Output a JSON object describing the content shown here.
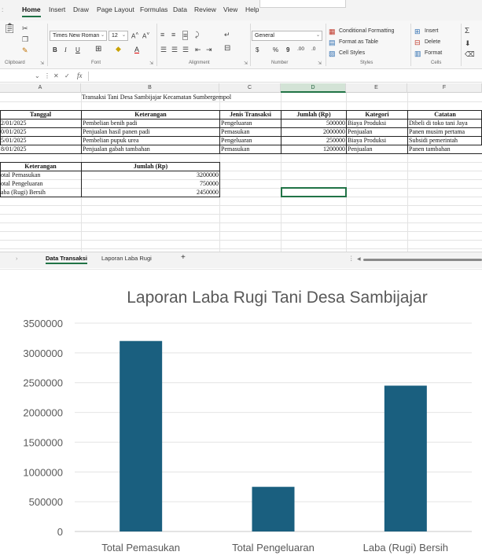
{
  "ribbon": {
    "tabs": [
      "Home",
      "Insert",
      "Draw",
      "Page Layout",
      "Formulas",
      "Data",
      "Review",
      "View",
      "Help"
    ],
    "font_name": "Times New Roman",
    "font_size": "12",
    "number_format": "General",
    "groups": {
      "clipboard": "Clipboard",
      "font": "Font",
      "alignment": "Alignment",
      "number": "Number",
      "styles": "Styles",
      "cells": "Cells"
    },
    "styles_items": [
      "Conditional Formatting",
      "Format as Table",
      "Cell Styles"
    ],
    "cells_items": [
      "Insert",
      "Delete",
      "Format"
    ],
    "number_symbols": [
      "$",
      "%",
      "9",
      ".00",
      ".0"
    ]
  },
  "formula_bar": {
    "fx": "fx"
  },
  "columns": [
    "A",
    "B",
    "C",
    "D",
    "E",
    "F"
  ],
  "sheet": {
    "title": "Transaksi Tani Desa Sambijajar Kecamatan Sumbergempol",
    "table_headers": [
      "Tanggal",
      "Keterangan",
      "Jenis Transaksi",
      "Jumlah (Rp)",
      "Kategori",
      "Catatan"
    ],
    "rows": [
      [
        "2/01/2025",
        "Pembelian benih padi",
        "Pengeluaran",
        "500000",
        "Biaya Produksi",
        "Dibeli di toko tani Jaya"
      ],
      [
        "0/01/2025",
        "Penjualan hasil panen padi",
        "Pemasukan",
        "2000000",
        "Penjualan",
        "Panen musim pertama"
      ],
      [
        "5/01/2025",
        "Pembelian pupuk urea",
        "Pengeluaran",
        "250000",
        "Biaya Produksi",
        "Subsidi pemerintah"
      ],
      [
        "8/01/2025",
        "Penjualan gabah tambahan",
        "Pemasukan",
        "1200000",
        "Penjualan",
        "Panen tambahan"
      ]
    ],
    "summary_headers": [
      "Keterangan",
      "Jumlah (Rp)"
    ],
    "summary_rows": [
      [
        "otal Pemasukan",
        "3200000"
      ],
      [
        "otal Pengeluaran",
        "750000"
      ],
      [
        "aba (Rugi) Bersih",
        "2450000"
      ]
    ]
  },
  "sheet_tabs": [
    "Data Transaksi",
    "Laporan Laba Rugi"
  ],
  "add_sheet": "+",
  "colors": {
    "accent": "#217346",
    "bar": "#1a5f7f"
  },
  "chart_data": {
    "type": "bar",
    "title": "Laporan Laba Rugi Tani Desa Sambijajar",
    "categories": [
      "Total Pemasukan",
      "Total Pengeluaran",
      "Laba (Rugi) Bersih"
    ],
    "values": [
      3200000,
      750000,
      2450000
    ],
    "ylim": [
      0,
      3500000
    ],
    "yticks": [
      "0",
      "500000",
      "1000000",
      "1500000",
      "2000000",
      "2500000",
      "3000000",
      "3500000"
    ],
    "grid": true,
    "legend": "none"
  }
}
